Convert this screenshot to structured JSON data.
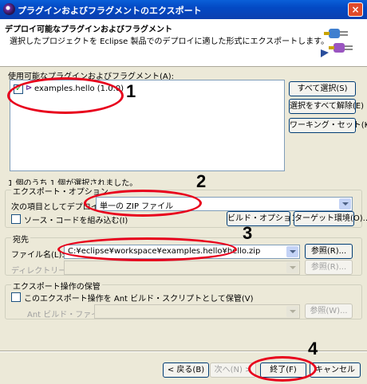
{
  "window": {
    "title": "プラグインおよびフラグメントのエクスポート",
    "close": "×"
  },
  "header": {
    "title": "デプロイ可能なプラグインおよびフラグメント",
    "description": "選択したプロジェクトを Eclipse 製品でのデプロイに適した形式にエクスポートします。"
  },
  "list": {
    "label": "使用可能なプラグインおよびフラグメント(A):",
    "items": [
      {
        "label": "examples.hello (1.0.0)",
        "checked": true
      }
    ],
    "status": "1 個のうち 1 個が選択されました。"
  },
  "side_buttons": {
    "select_all": "すべて選択(S)",
    "deselect_all": "選択をすべて解除(E)",
    "working_set": "ワーキング・セット(K)..."
  },
  "export_options": {
    "legend": "エクスポート・オプション",
    "deploy_label": "次の項目としてデプロイ(Y):",
    "deploy_value": "単一の ZIP ファイル",
    "source_label": "ソース・コードを組み込む(I)",
    "build_options": "ビルド・オプション(U)...",
    "target_env": "ターゲット環境(O)..."
  },
  "destination": {
    "legend": "宛先",
    "file_label": "ファイル名(L):",
    "file_value": "C:¥eclipse¥workspace¥examples.hello¥hello.zip",
    "browse1": "参照(R)...",
    "dir_label": "ディレクトリー(Y):",
    "browse2": "参照(R)..."
  },
  "save_op": {
    "legend": "エクスポート操作の保管",
    "ant_label": "このエクスポート操作を Ant ビルド・スクリプトとして保管(V)",
    "ant_file_label": "Ant ビルド・ファイル(I):",
    "browse": "参照(W)..."
  },
  "footer": {
    "back": "< 戻る(B)",
    "next": "次へ(N) >",
    "finish": "終了(F)",
    "cancel": "キャンセル"
  },
  "annotations": [
    "1",
    "2",
    "3",
    "4"
  ],
  "colors": {
    "annotation": "#e8001c",
    "title_bar": "#0349c4"
  }
}
